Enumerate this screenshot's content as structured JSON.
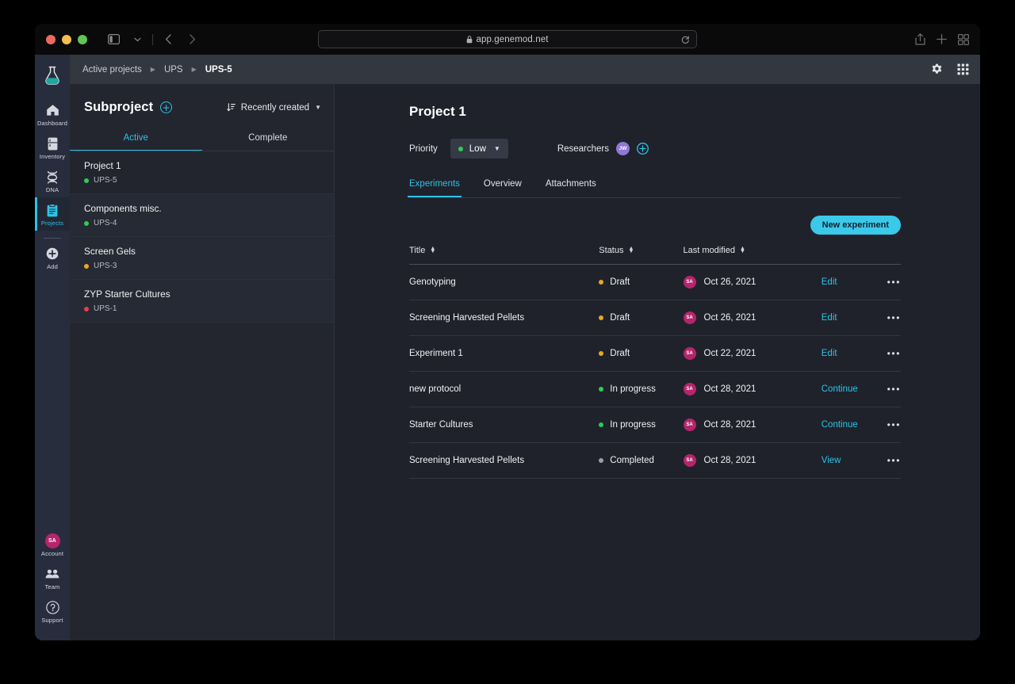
{
  "browser": {
    "url": "app.genemod.net",
    "lock_icon": "lock-icon",
    "reload_icon": "reload-icon",
    "reader_icon": "reader-view-icon",
    "sidebar_toggle_icon": "sidebar-toggle-icon",
    "chevron_down_icon": "chevron-down-icon",
    "back_icon": "back-arrow-icon",
    "forward_icon": "forward-arrow-icon",
    "share_icon": "share-icon",
    "new_tab_icon": "plus-icon",
    "tab_overview_icon": "tab-overview-icon"
  },
  "rail": {
    "logo_icon": "genemod-flask-logo",
    "items": [
      {
        "label": "Dashboard",
        "icon": "home-icon",
        "active": false
      },
      {
        "label": "Inventory",
        "icon": "fridge-icon",
        "active": false
      },
      {
        "label": "DNA",
        "icon": "dna-helix-icon",
        "active": false
      },
      {
        "label": "Projects",
        "icon": "clipboard-icon",
        "active": true
      },
      {
        "label": "Add",
        "icon": "plus-circle-icon",
        "active": false
      }
    ],
    "bottom": [
      {
        "label": "Account",
        "icon": "avatar-icon",
        "initials": "SA"
      },
      {
        "label": "Team",
        "icon": "team-icon"
      },
      {
        "label": "Support",
        "icon": "question-circle-icon"
      }
    ]
  },
  "topbar": {
    "breadcrumb": [
      "Active projects",
      "UPS",
      "UPS-5"
    ],
    "separator": "▶",
    "settings_icon": "gear-icon",
    "apps_icon": "grid-apps-icon"
  },
  "subpanel": {
    "title": "Subproject",
    "add_icon": "plus-circle-icon",
    "sort_icon": "sort-descending-icon",
    "sort_value": "Recently created",
    "sort_caret": "▼",
    "tabs": [
      {
        "label": "Active",
        "active": true
      },
      {
        "label": "Complete",
        "active": false
      }
    ],
    "projects": [
      {
        "name": "Project 1",
        "code": "UPS-5",
        "dot_color": "#2ecc55",
        "selected": true
      },
      {
        "name": "Components misc.",
        "code": "UPS-4",
        "dot_color": "#2ecc55",
        "selected": false
      },
      {
        "name": "Screen Gels",
        "code": "UPS-3",
        "dot_color": "#e9a820",
        "selected": false
      },
      {
        "name": "ZYP Starter Cultures",
        "code": "UPS-1",
        "dot_color": "#e0434a",
        "selected": false
      }
    ]
  },
  "detail": {
    "title": "Project 1",
    "priority_label": "Priority",
    "priority_value": "Low",
    "priority_dot_color": "#2ecc55",
    "priority_caret": "▼",
    "researchers_label": "Researchers",
    "researcher_initials": "JW",
    "add_researcher_icon": "plus-circle-icon",
    "tabs": [
      {
        "label": "Experiments",
        "active": true
      },
      {
        "label": "Overview",
        "active": false
      },
      {
        "label": "Attachments",
        "active": false
      }
    ],
    "new_experiment_label": "New experiment",
    "table": {
      "columns": [
        "Title",
        "Status",
        "Last modified",
        "",
        ""
      ],
      "rows": [
        {
          "title": "Genotyping",
          "status": "Draft",
          "status_color": "#e9a820",
          "initials": "SA",
          "modified": "Oct 26, 2021",
          "action": "Edit",
          "menu_icon": "more-horizontal-icon"
        },
        {
          "title": "Screening Harvested Pellets",
          "status": "Draft",
          "status_color": "#e9a820",
          "initials": "SA",
          "modified": "Oct 26, 2021",
          "action": "Edit",
          "menu_icon": "more-horizontal-icon"
        },
        {
          "title": "Experiment 1",
          "status": "Draft",
          "status_color": "#e9a820",
          "initials": "SA",
          "modified": "Oct 22, 2021",
          "action": "Edit",
          "menu_icon": "more-horizontal-icon"
        },
        {
          "title": "new protocol",
          "status": "In progress",
          "status_color": "#2ecc55",
          "initials": "SA",
          "modified": "Oct 28, 2021",
          "action": "Continue",
          "menu_icon": "more-horizontal-icon"
        },
        {
          "title": "Starter Cultures",
          "status": "In progress",
          "status_color": "#2ecc55",
          "initials": "SA",
          "modified": "Oct 28, 2021",
          "action": "Continue",
          "menu_icon": "more-horizontal-icon"
        },
        {
          "title": "Screening Harvested Pellets",
          "status": "Completed",
          "status_color": "#9aa0ab",
          "initials": "SA",
          "modified": "Oct 28, 2021",
          "action": "View",
          "menu_icon": "more-horizontal-icon"
        }
      ]
    }
  },
  "colors": {
    "accent": "#2cc3e8",
    "button": "#3bc9ea",
    "rail_bg": "#282d3d",
    "panel_bg": "#23262f",
    "content_bg": "#1f222b",
    "topbar_bg": "#33373f"
  }
}
